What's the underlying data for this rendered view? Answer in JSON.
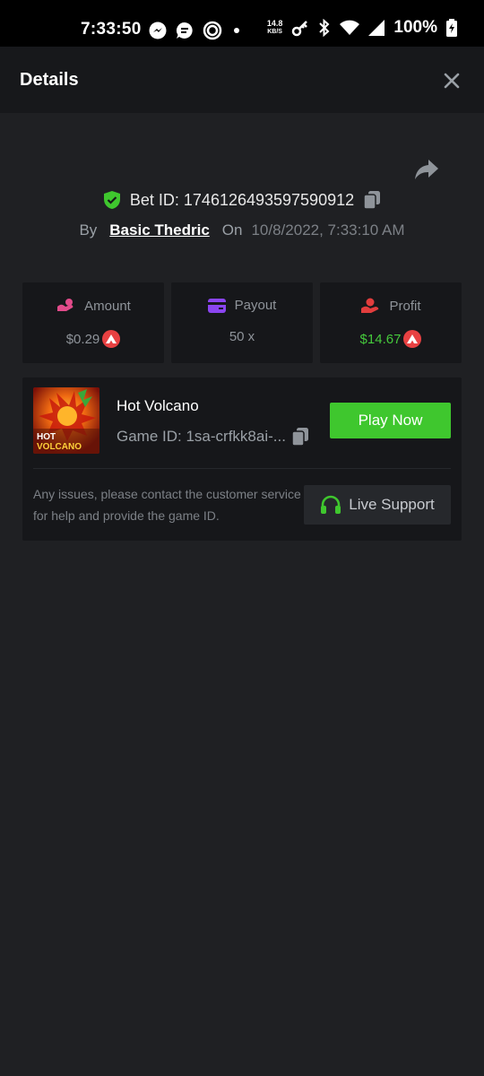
{
  "status_bar": {
    "time": "7:33:50",
    "speed_value": "14.8",
    "speed_unit": "KB/S",
    "battery": "100%"
  },
  "header": {
    "title": "Details"
  },
  "bet": {
    "bet_id_label": "Bet ID:",
    "bet_id": "1746126493597590912",
    "by_label": "By",
    "username": "Basic Thedric",
    "on_label": "On",
    "date": "10/8/2022, 7:33:10 AM"
  },
  "stats": {
    "amount_label": "Amount",
    "amount_value": "$0.29",
    "payout_label": "Payout",
    "payout_value": "50 x",
    "profit_label": "Profit",
    "profit_value": "$14.67"
  },
  "game": {
    "name": "Hot Volcano",
    "game_id_text": "Game ID: 1sa-crfkk8ai-...",
    "thumb_line1": "HOT",
    "thumb_line2": "VOLCANO",
    "play_label": "Play Now",
    "issue_text": "Any issues, please contact the customer service for help and provide the game ID.",
    "support_label": "Live Support"
  },
  "colors": {
    "background": "#1f2023",
    "panel": "#16171a",
    "accent_green": "#3fc72e",
    "profit_green": "#45c93c",
    "coin_red": "#e84142",
    "shield_green": "#3fc72e"
  },
  "icons": [
    "messenger-icon",
    "chat-icon",
    "sync-icon",
    "key-icon",
    "bluetooth-icon",
    "wifi-icon",
    "signal-icon",
    "battery-icon",
    "close-icon",
    "share-icon",
    "shield-check-icon",
    "copy-icon",
    "money-icon",
    "card-icon",
    "hand-profit-icon",
    "avax-coin-icon",
    "headset-icon"
  ]
}
